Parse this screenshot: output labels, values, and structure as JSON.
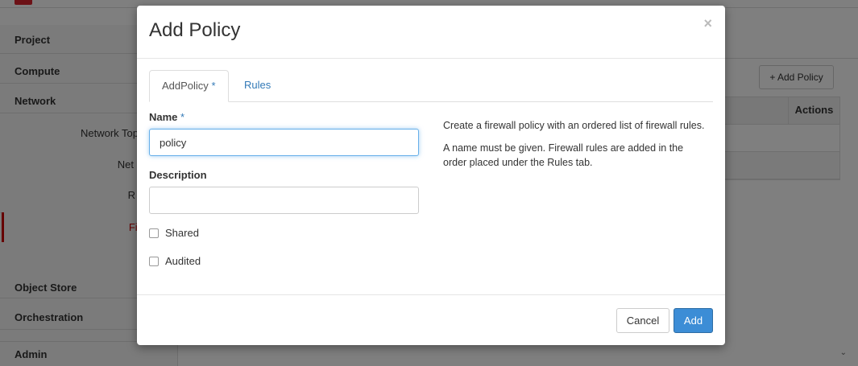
{
  "background": {
    "sidebar": {
      "project": "Project",
      "compute": "Compute",
      "network": "Network",
      "sub_items": [
        "Network Top",
        "Net",
        "R"
      ],
      "active_item": "Fir",
      "object_store": "Object Store",
      "orchestration": "Orchestration",
      "admin": "Admin"
    },
    "add_policy_button": "+ Add Policy",
    "table_actions_header": "Actions"
  },
  "modal": {
    "title": "Add Policy",
    "close_glyph": "×",
    "tabs": {
      "tab1_label": "AddPolicy",
      "tab1_required": "*",
      "tab2_label": "Rules"
    },
    "form": {
      "name_label": "Name",
      "name_required": "*",
      "name_value": "policy",
      "description_label": "Description",
      "description_value": "",
      "shared_label": "Shared",
      "audited_label": "Audited"
    },
    "help": {
      "line1": "Create a firewall policy with an ordered list of firewall rules.",
      "line2": "A name must be given. Firewall rules are added in the order placed under the Rules tab."
    },
    "footer": {
      "cancel_label": "Cancel",
      "add_label": "Add"
    }
  }
}
